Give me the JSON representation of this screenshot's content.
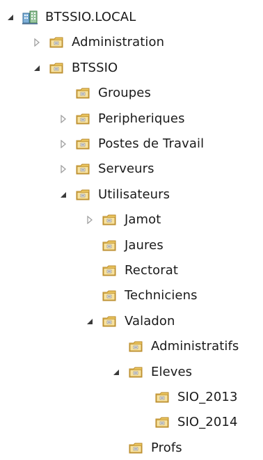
{
  "tree": {
    "nodes": [
      {
        "id": "btssio-local",
        "label": "BTSSIO.LOCAL",
        "icon": "domain-icon",
        "toggle": "expanded",
        "level": 0
      },
      {
        "id": "administration",
        "label": "Administration",
        "icon": "folder-icon",
        "toggle": "collapsed",
        "level": 1
      },
      {
        "id": "btssio",
        "label": "BTSSIO",
        "icon": "folder-icon",
        "toggle": "expanded",
        "level": 1
      },
      {
        "id": "groupes",
        "label": "Groupes",
        "icon": "folder-icon",
        "toggle": "none",
        "level": 2
      },
      {
        "id": "peripheriques",
        "label": "Peripheriques",
        "icon": "folder-icon",
        "toggle": "collapsed",
        "level": 2
      },
      {
        "id": "postes-de-travail",
        "label": "Postes de Travail",
        "icon": "folder-icon",
        "toggle": "collapsed",
        "level": 2
      },
      {
        "id": "serveurs",
        "label": "Serveurs",
        "icon": "folder-icon",
        "toggle": "collapsed",
        "level": 2
      },
      {
        "id": "utilisateurs",
        "label": "Utilisateurs",
        "icon": "folder-icon",
        "toggle": "expanded",
        "level": 2
      },
      {
        "id": "jamot",
        "label": "Jamot",
        "icon": "folder-icon",
        "toggle": "collapsed",
        "level": 3
      },
      {
        "id": "jaures",
        "label": "Jaures",
        "icon": "folder-icon",
        "toggle": "none",
        "level": 3
      },
      {
        "id": "rectorat",
        "label": "Rectorat",
        "icon": "folder-icon",
        "toggle": "none",
        "level": 3
      },
      {
        "id": "techniciens",
        "label": "Techniciens",
        "icon": "folder-icon",
        "toggle": "none",
        "level": 3
      },
      {
        "id": "valadon",
        "label": "Valadon",
        "icon": "folder-icon",
        "toggle": "expanded",
        "level": 3
      },
      {
        "id": "administratifs",
        "label": "Administratifs",
        "icon": "folder-icon",
        "toggle": "none",
        "level": 4
      },
      {
        "id": "eleves",
        "label": "Eleves",
        "icon": "folder-icon",
        "toggle": "expanded",
        "level": 4
      },
      {
        "id": "sio-2013",
        "label": "SIO_2013",
        "icon": "folder-icon",
        "toggle": "none",
        "level": 5
      },
      {
        "id": "sio-2014",
        "label": "SIO_2014",
        "icon": "folder-icon",
        "toggle": "none",
        "level": 5
      },
      {
        "id": "profs",
        "label": "Profs",
        "icon": "folder-icon",
        "toggle": "none",
        "level": 4
      }
    ]
  },
  "colors": {
    "text": "#1a1a1a",
    "toggle_expanded": "#3a3a3a",
    "toggle_collapsed": "#a0a0a0",
    "folder_body": "#e8c25c",
    "folder_light": "#f7e2a0",
    "folder_edge": "#b88a2a"
  }
}
